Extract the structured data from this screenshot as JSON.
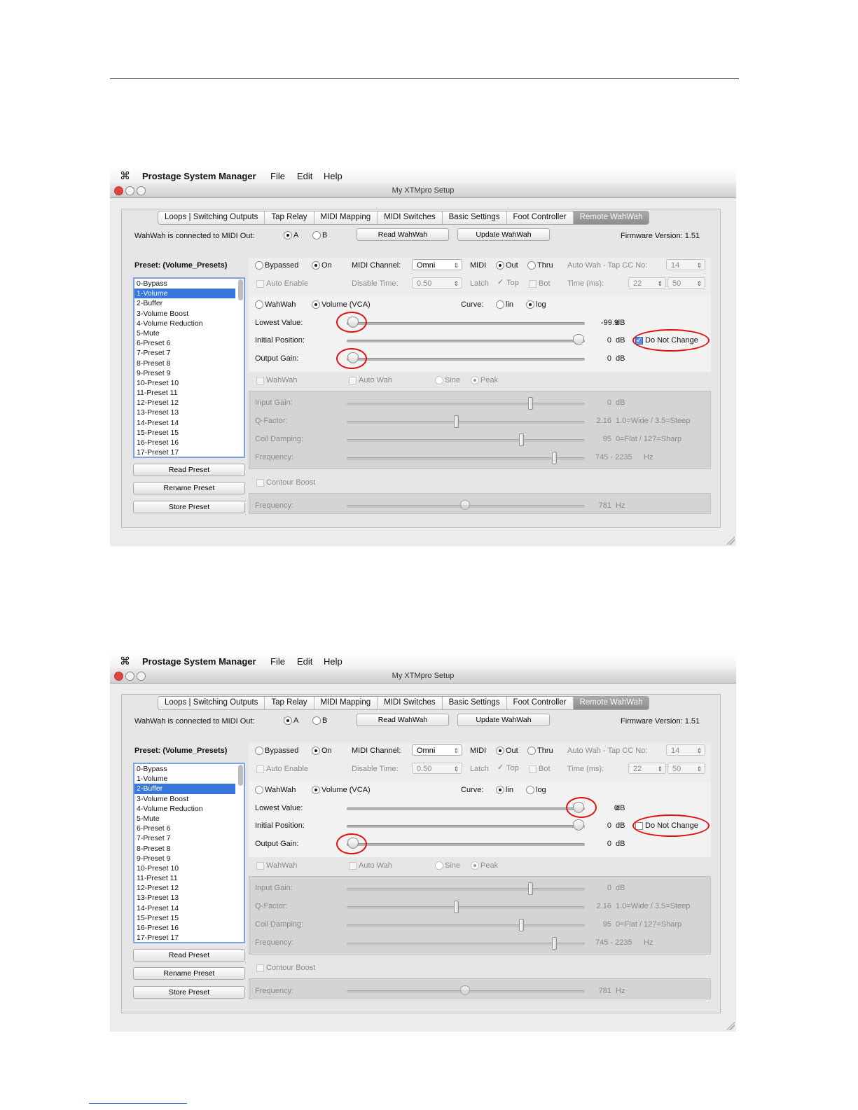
{
  "menubar": {
    "app_name": "Prostage System Manager",
    "menus": [
      "File",
      "Edit",
      "Help"
    ]
  },
  "window_title": "My XTMpro Setup",
  "tabs": [
    "Loops | Switching Outputs",
    "Tap Relay",
    "MIDI Mapping",
    "MIDI Switches",
    "Basic Settings",
    "Foot Controller",
    "Remote WahWah"
  ],
  "connection": {
    "label": "WahWah is connected to MIDI Out:",
    "options": [
      "A",
      "B"
    ],
    "selected": "A",
    "read_button": "Read WahWah",
    "update_button": "Update WahWah",
    "firmware": "Firmware Version: 1.51"
  },
  "preset_panel": {
    "title": "Preset: (Volume_Presets)",
    "items": [
      "0-Bypass",
      "1-Volume",
      "2-Buffer",
      "3-Volume Boost",
      "4-Volume Reduction",
      "5-Mute",
      "6-Preset 6",
      "7-Preset 7",
      "8-Preset 8",
      "9-Preset 9",
      "10-Preset 10",
      "11-Preset 11",
      "12-Preset 12",
      "13-Preset 13",
      "14-Preset 14",
      "15-Preset 15",
      "16-Preset 16",
      "17-Preset 17"
    ],
    "read_button": "Read Preset",
    "rename_button": "Rename Preset",
    "store_button": "Store Preset"
  },
  "controls": {
    "bypassed": "Bypassed",
    "on": "On",
    "auto_enable": "Auto Enable",
    "midi_channel_label": "MIDI Channel:",
    "midi_channel_value": "Omni",
    "disable_time_label": "Disable Time:",
    "disable_time_value": "0.50",
    "midi_label": "MIDI",
    "out": "Out",
    "thru": "Thru",
    "latch": "Latch",
    "top": "Top",
    "bot": "Bot",
    "auto_wah_cc_label": "Auto Wah - Tap CC No:",
    "auto_wah_cc_value": "14",
    "time_label": "Time (ms):",
    "time_value_1": "22",
    "time_value_2": "50",
    "wahwah": "WahWah",
    "volume_vca": "Volume (VCA)",
    "curve_label": "Curve:",
    "lin": "lin",
    "log": "log",
    "lowest_value": "Lowest Value:",
    "initial_position": "Initial Position:",
    "output_gain": "Output Gain:",
    "do_not_change": "Do Not Change",
    "db": "dB",
    "wah_section_wahwah": "WahWah",
    "auto_wah": "Auto Wah",
    "sine": "Sine",
    "peak": "Peak",
    "input_gain": "Input Gain:",
    "q_factor": "Q-Factor:",
    "coil_damping": "Coil Damping:",
    "frequency": "Frequency:",
    "input_gain_value": "0",
    "q_factor_value": "2.16",
    "q_factor_hint": "1.0=Wide / 3.5=Steep",
    "coil_damping_value": "95",
    "coil_damping_hint": "0=Flat / 127=Sharp",
    "frequency_value": "745 - 2235",
    "hz": "Hz",
    "contour_boost": "Contour Boost",
    "contour_frequency_value": "781"
  },
  "screenshots": [
    {
      "selected_preset": "1-Volume",
      "curve": "log",
      "lowest_value": "-99.9",
      "initial_position": "0",
      "output_gain": "0",
      "do_not_change_checked": true
    },
    {
      "selected_preset": "2-Buffer",
      "curve": "lin",
      "lowest_value": "0",
      "initial_position": "0",
      "output_gain": "0",
      "do_not_change_checked": false
    }
  ],
  "colors": {
    "highlight_ring": "#e01010",
    "selection": "#3876d9",
    "active_tab": "#999999"
  }
}
